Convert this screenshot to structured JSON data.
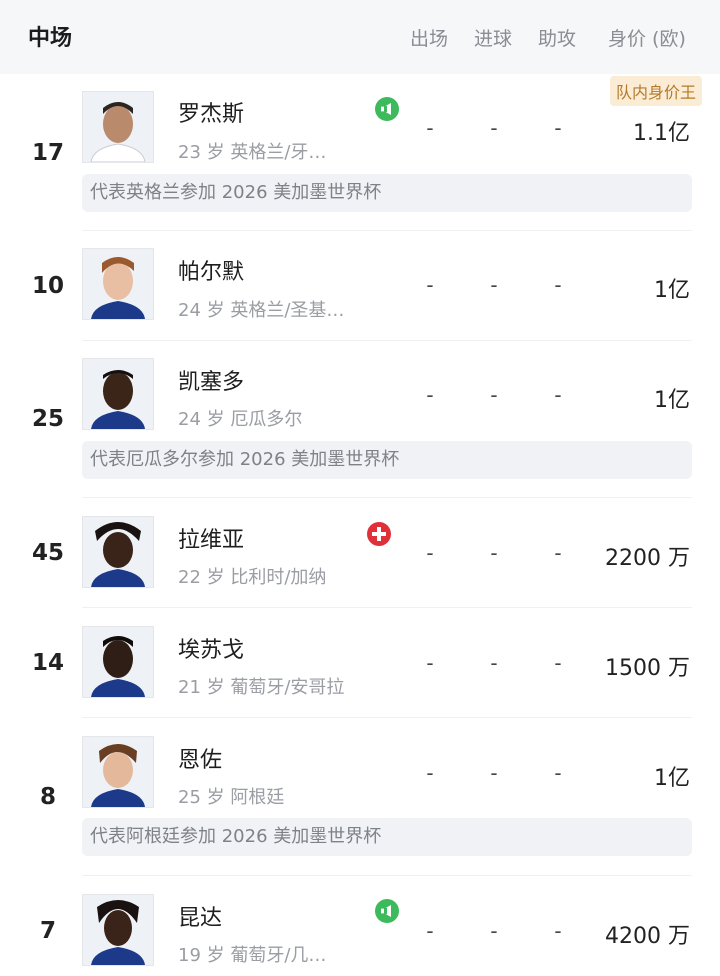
{
  "header": {
    "title": "中场",
    "col_apps": "出场",
    "col_goals": "进球",
    "col_assists": "助攻",
    "col_value": "身价 (欧)"
  },
  "top_badge": "队内身价王",
  "players": [
    {
      "number": "17",
      "name": "罗杰斯",
      "meta": "23 岁  英格兰/牙…",
      "apps": "-",
      "goals": "-",
      "assists": "-",
      "value": "1.1亿",
      "status_icon": "substitute-icon",
      "note": "代表英格兰参加 2026 美加墨世界杯",
      "jersey_color": "#ffffff"
    },
    {
      "number": "10",
      "name": "帕尔默",
      "meta": "24 岁  英格兰/圣基…",
      "apps": "-",
      "goals": "-",
      "assists": "-",
      "value": "1亿",
      "status_icon": null,
      "note": null,
      "jersey_color": "#1d3a8a"
    },
    {
      "number": "25",
      "name": "凯塞多",
      "meta": "24 岁  厄瓜多尔",
      "apps": "-",
      "goals": "-",
      "assists": "-",
      "value": "1亿",
      "status_icon": null,
      "note": "代表厄瓜多尔参加 2026 美加墨世界杯",
      "jersey_color": "#1d3a8a"
    },
    {
      "number": "45",
      "name": "拉维亚",
      "meta": "22 岁  比利时/加纳",
      "apps": "-",
      "goals": "-",
      "assists": "-",
      "value": "2200 万",
      "status_icon": "injury-icon",
      "note": null,
      "jersey_color": "#1d3a8a"
    },
    {
      "number": "14",
      "name": "埃苏戈",
      "meta": "21 岁  葡萄牙/安哥拉",
      "apps": "-",
      "goals": "-",
      "assists": "-",
      "value": "1500 万",
      "status_icon": null,
      "note": null,
      "jersey_color": "#1d3a8a"
    },
    {
      "number": "8",
      "name": "恩佐",
      "meta": "25 岁  阿根廷",
      "apps": "-",
      "goals": "-",
      "assists": "-",
      "value": "1亿",
      "status_icon": null,
      "note": "代表阿根廷参加 2026 美加墨世界杯",
      "jersey_color": "#1d3a8a"
    },
    {
      "number": "7",
      "name": "昆达",
      "meta": "19 岁  葡萄牙/几…",
      "apps": "-",
      "goals": "-",
      "assists": "-",
      "value": "4200 万",
      "status_icon": "substitute-icon",
      "note": null,
      "jersey_color": "#1d3a8a"
    }
  ],
  "colors": {
    "header_bg": "#f6f7f8",
    "note_bg": "#f0f2f5",
    "badge_bg": "#fbecd6",
    "badge_text": "#b57a2a",
    "sub_green": "#3dbb5c",
    "injury_red": "#e0303a"
  }
}
